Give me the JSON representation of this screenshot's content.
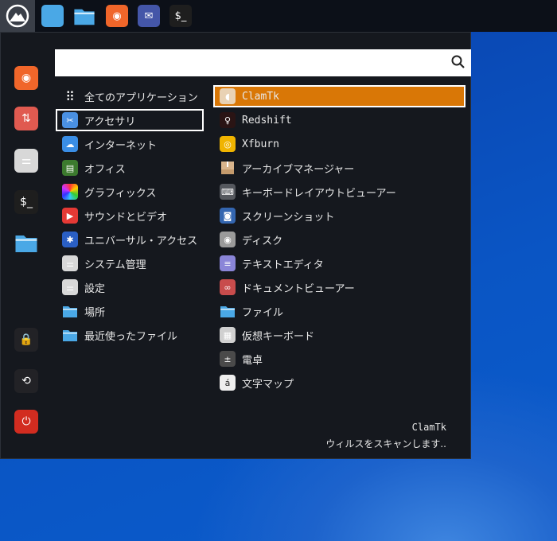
{
  "taskbar": {
    "items": [
      {
        "name": "show-desktop",
        "color": "#4aa8e6",
        "glyph": ""
      },
      {
        "name": "file-manager",
        "color": "#4aa8e6",
        "glyph": ""
      },
      {
        "name": "firefox",
        "color": "#f0662a",
        "glyph": "◉"
      },
      {
        "name": "mail",
        "color": "#4456a8",
        "glyph": "✉"
      },
      {
        "name": "terminal",
        "color": "#1e1e1e",
        "glyph": "$_"
      }
    ]
  },
  "search": {
    "value": "",
    "placeholder": ""
  },
  "sidebar": [
    {
      "name": "firefox",
      "color": "#f0662a",
      "glyph": "◉"
    },
    {
      "name": "software-updater",
      "color": "#e05a50",
      "glyph": "⇅"
    },
    {
      "name": "settings",
      "color": "#d8d8d8",
      "glyph": "⚌"
    },
    {
      "name": "terminal",
      "color": "#1e1e1e",
      "glyph": "$_"
    },
    {
      "name": "files",
      "color": "#4aa8e6",
      "glyph": ""
    },
    {
      "name": "lock",
      "color": "#222226",
      "glyph": "🔒"
    },
    {
      "name": "logout",
      "color": "#222226",
      "glyph": "⟲"
    },
    {
      "name": "power",
      "color": "#d22c20",
      "glyph": "⏻"
    }
  ],
  "categories": [
    {
      "label": "全てのアプリケーション",
      "icon": "grid",
      "color": "transparent",
      "glyph": "⠿"
    },
    {
      "label": "アクセサリ",
      "icon": "scissors",
      "color": "#4a90e2",
      "glyph": "✂"
    },
    {
      "label": "インターネット",
      "icon": "cloud",
      "color": "#3a8ee6",
      "glyph": "☁"
    },
    {
      "label": "オフィス",
      "icon": "office",
      "color": "#3c7a2e",
      "glyph": "▤"
    },
    {
      "label": "グラフィックス",
      "icon": "graphics",
      "color": "#b03ad0",
      "glyph": ""
    },
    {
      "label": "サウンドとビデオ",
      "icon": "play",
      "color": "#e53935",
      "glyph": "▶"
    },
    {
      "label": "ユニバーサル・アクセス",
      "icon": "accessibility",
      "color": "#2a5fc4",
      "glyph": "✱"
    },
    {
      "label": "システム管理",
      "icon": "system",
      "color": "#d8d8d8",
      "glyph": "⚌"
    },
    {
      "label": "設定",
      "icon": "settings",
      "color": "#d8d8d8",
      "glyph": "⚌"
    },
    {
      "label": "場所",
      "icon": "folder",
      "color": "#4aa8e6",
      "glyph": ""
    },
    {
      "label": "最近使ったファイル",
      "icon": "recent-folder",
      "color": "#4aa8e6",
      "glyph": "◷"
    }
  ],
  "apps": [
    {
      "label": "ClamTk",
      "icon": "clamtk",
      "color": "#e9d2b4",
      "glyph": "◖"
    },
    {
      "label": "Redshift",
      "icon": "redshift",
      "color": "#2a1414",
      "glyph": "♀"
    },
    {
      "label": "Xfburn",
      "icon": "xfburn",
      "color": "#f0b400",
      "glyph": "◎"
    },
    {
      "label": "アーカイブマネージャー",
      "icon": "archive",
      "color": "#caa27a",
      "glyph": ""
    },
    {
      "label": "キーボードレイアウトビューアー",
      "icon": "keyboard",
      "color": "#55585e",
      "glyph": "⌨"
    },
    {
      "label": "スクリーンショット",
      "icon": "camera",
      "color": "#3466b0",
      "glyph": "◙"
    },
    {
      "label": "ディスク",
      "icon": "disk",
      "color": "#9a9a9a",
      "glyph": "◉"
    },
    {
      "label": "テキストエディタ",
      "icon": "text-editor",
      "color": "#8a85d8",
      "glyph": "≡"
    },
    {
      "label": "ドキュメントビューアー",
      "icon": "document-viewer",
      "color": "#c84c4c",
      "glyph": "∞"
    },
    {
      "label": "ファイル",
      "icon": "folder",
      "color": "#4aa8e6",
      "glyph": ""
    },
    {
      "label": "仮想キーボード",
      "icon": "onscreen-keyboard",
      "color": "#d0d0d0",
      "glyph": "▦"
    },
    {
      "label": "電卓",
      "icon": "calculator",
      "color": "#4a4a4a",
      "glyph": "±"
    },
    {
      "label": "文字マップ",
      "icon": "charmap",
      "color": "#eeeeee",
      "glyph": "á"
    }
  ],
  "selected_app": "ClamTk",
  "description": {
    "title": "ClamTk",
    "text": "ウィルスをスキャンします.."
  }
}
